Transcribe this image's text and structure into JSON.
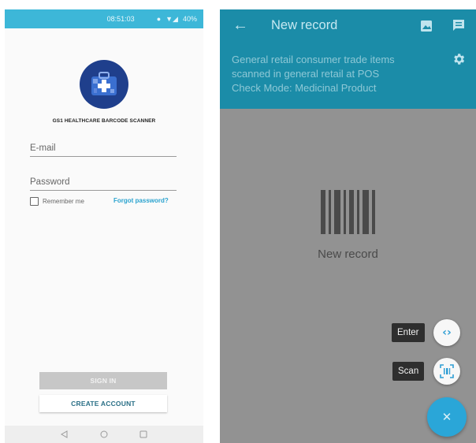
{
  "login": {
    "status": {
      "time": "08:51:03",
      "battery": "40%"
    },
    "app_title": "GS1 HEALTHCARE BARCODE SCANNER",
    "email_placeholder": "E-mail",
    "password_placeholder": "Password",
    "remember_label": "Remember me",
    "remember_checked": false,
    "forgot_label": "Forgot password?",
    "signin_label": "SIGN IN",
    "create_label": "CREATE ACCOUNT",
    "icons": [
      "back-nav-icon",
      "home-nav-icon",
      "recents-nav-icon"
    ]
  },
  "record": {
    "title": "New record",
    "info_lines": [
      "General retail consumer trade items",
      "scanned in general retail at POS",
      "Check Mode: Medicinal Product"
    ],
    "empty_label": "New record",
    "enter_label": "Enter",
    "scan_label": "Scan",
    "icons": [
      "arrow-back-icon",
      "image-icon",
      "comment-icon",
      "gear-icon",
      "barcode-icon",
      "code-icon",
      "scan-icon",
      "close-icon"
    ]
  },
  "colors": {
    "status_bar": "#3db7d8",
    "app_bar": "#1b8ca8",
    "link": "#2aa3cf",
    "fab": "#2aa6d8",
    "overlay": "#929292"
  }
}
